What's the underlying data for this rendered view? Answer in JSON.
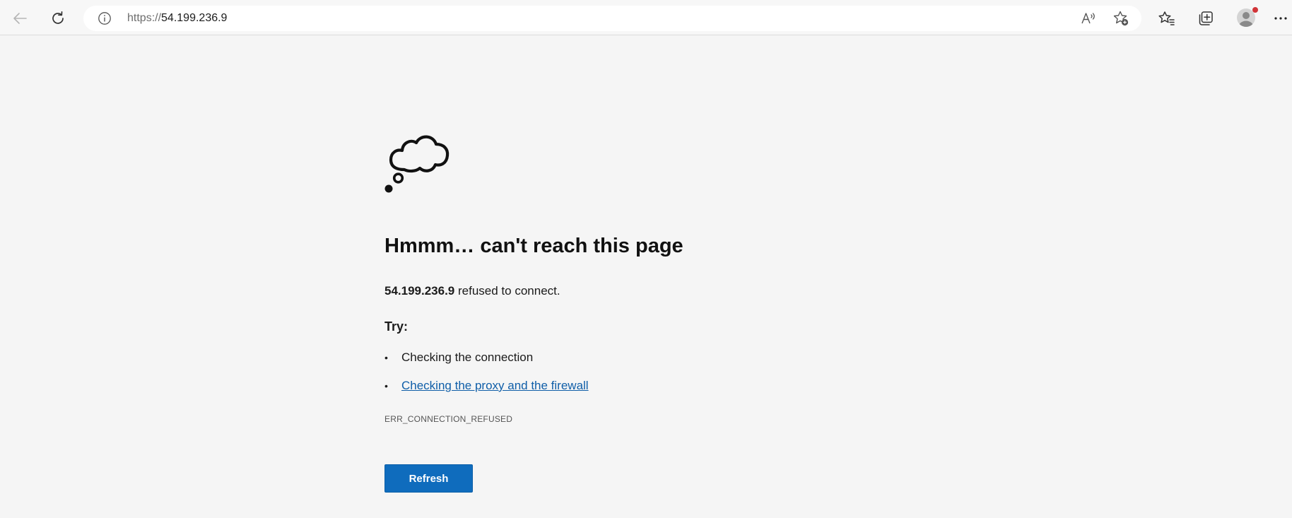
{
  "browser": {
    "address_bar": {
      "url_scheme": "https://",
      "url_host": "54.199.236.9"
    },
    "icons": {
      "back": "back-arrow-icon",
      "refresh": "refresh-icon",
      "site_info": "info-icon",
      "read_aloud": "read-aloud-icon",
      "add_favorite": "add-favorite-icon",
      "favorites": "favorites-icon",
      "collections": "collections-icon",
      "profile": "profile-avatar",
      "menu": "more-options-icon"
    },
    "notification_color": "#d13438"
  },
  "error_page": {
    "illustration": "thought-cloud-icon",
    "title": "Hmmm… can't reach this page",
    "host": "54.199.236.9",
    "message_suffix": "refused to connect.",
    "try_label": "Try:",
    "suggestions": [
      {
        "text": "Checking the connection",
        "is_link": false
      },
      {
        "text": "Checking the proxy and the firewall",
        "is_link": true
      }
    ],
    "error_code": "ERR_CONNECTION_REFUSED",
    "refresh_button": "Refresh",
    "accent_color": "#0f6cbd",
    "link_color": "#0f5ea8"
  }
}
